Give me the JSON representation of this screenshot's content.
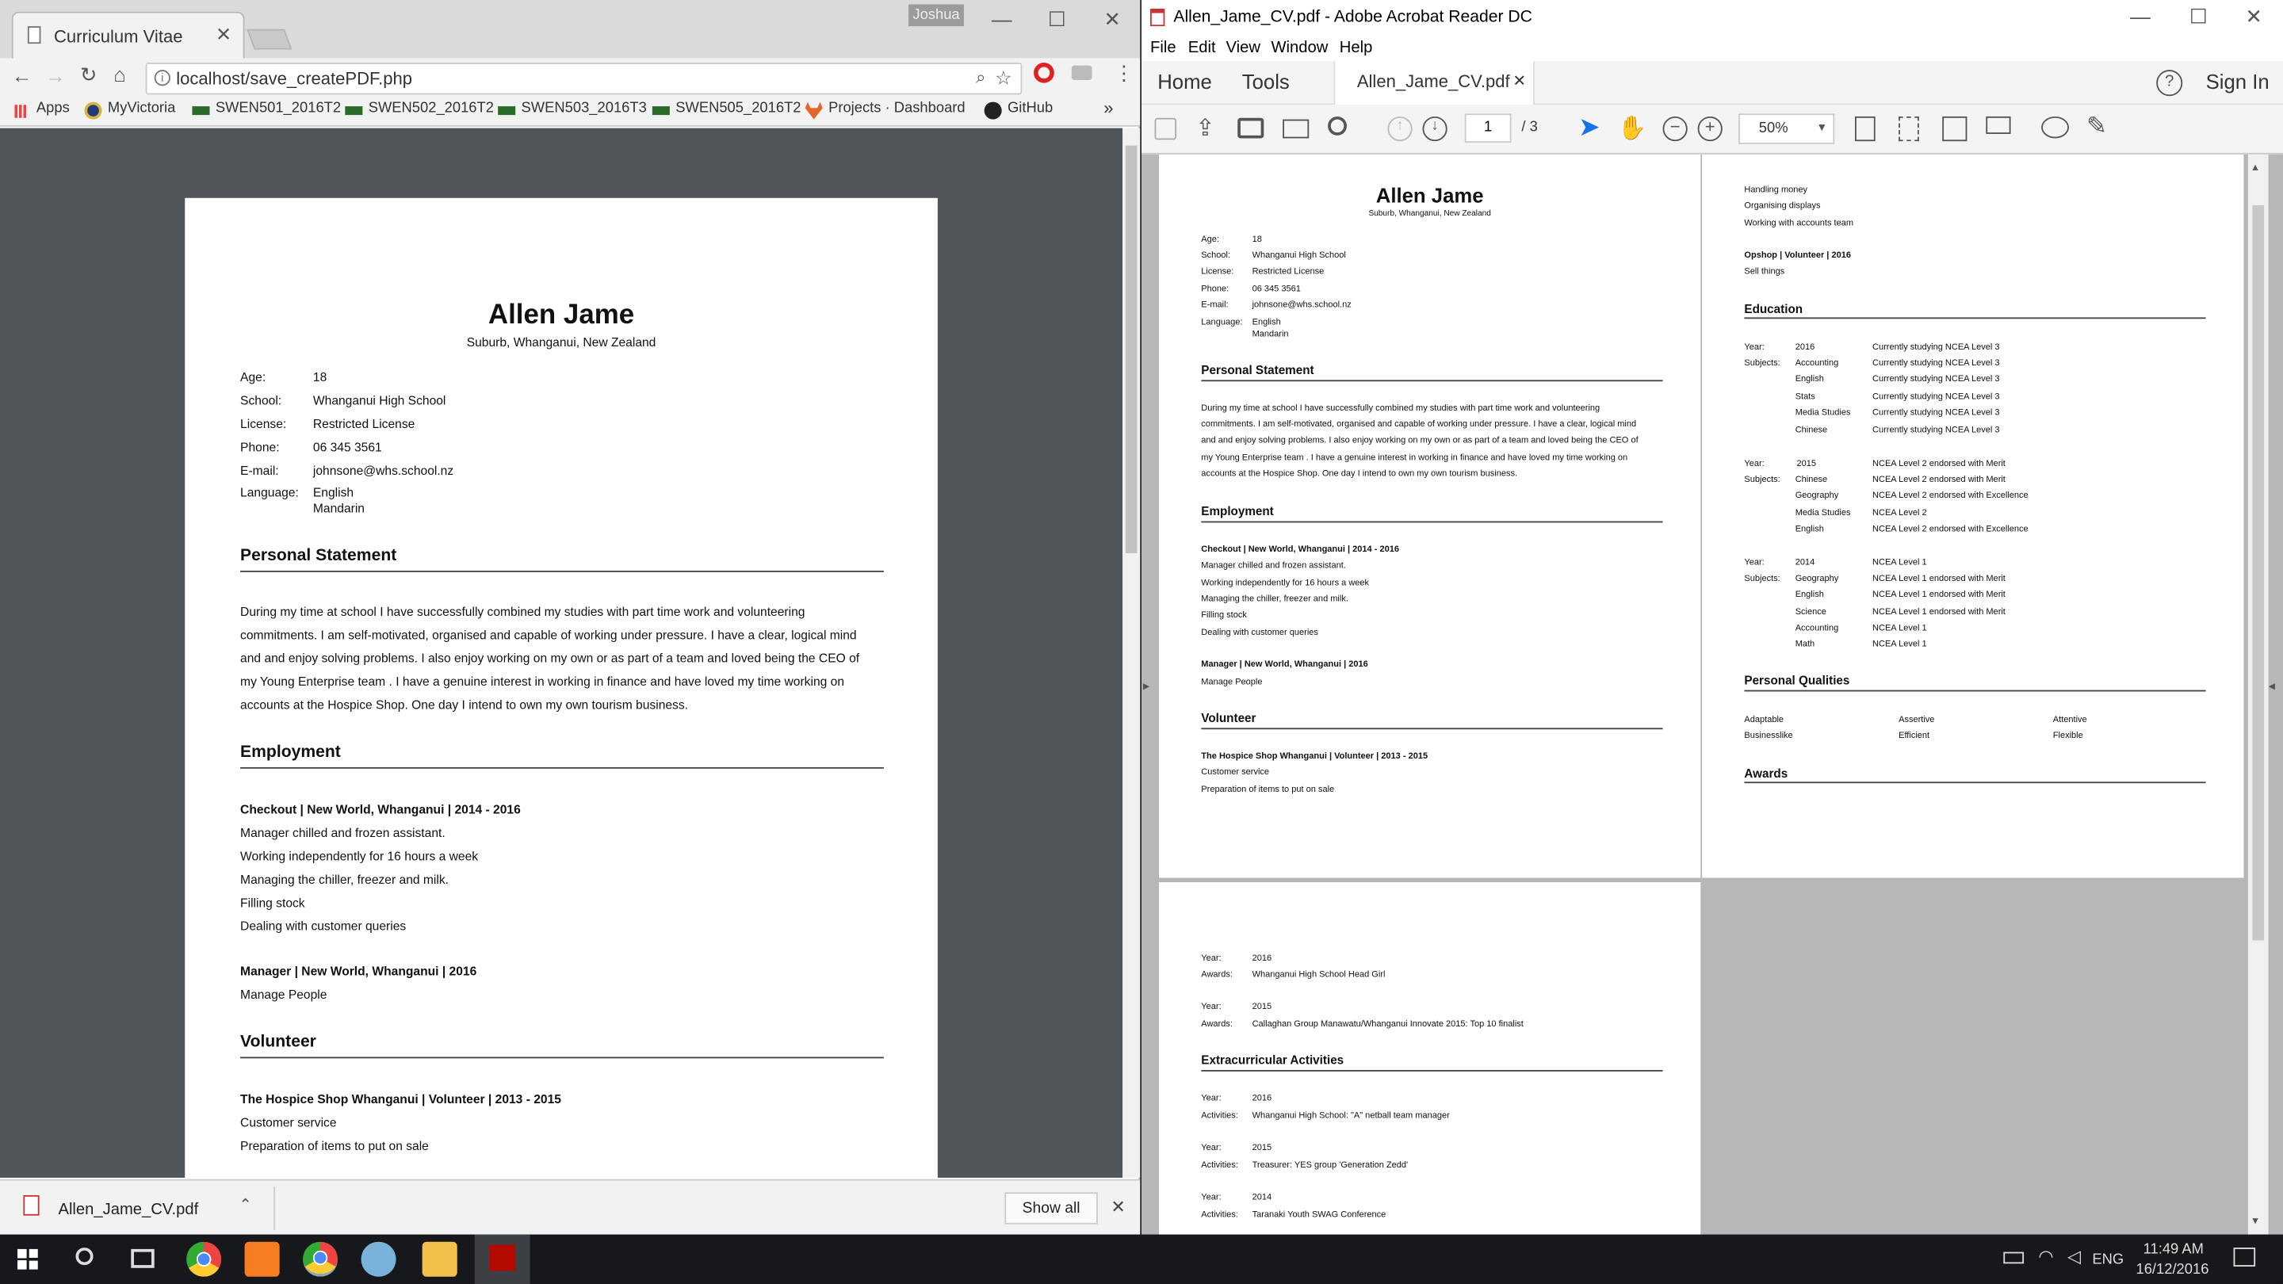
{
  "chrome": {
    "tab_title": "Curriculum Vitae",
    "profile_name": "Joshua",
    "url": "localhost/save_createPDF.php",
    "bookmarks": [
      "Apps",
      "MyVictoria",
      "SWEN501_2016T2",
      "SWEN502_2016T2",
      "SWEN503_2016T3",
      "SWEN505_2016T2",
      "Projects · Dashboard",
      "GitHub"
    ],
    "download_file": "Allen_Jame_CV.pdf",
    "show_all": "Show all"
  },
  "cv": {
    "name": "Allen Jame",
    "address": "Suburb, Whanganui, New Zealand",
    "details": [
      {
        "label": "Age:",
        "value": "18"
      },
      {
        "label": "School:",
        "value": "Whanganui High School"
      },
      {
        "label": "License:",
        "value": "Restricted License"
      },
      {
        "label": "Phone:",
        "value": "06 345 3561"
      },
      {
        "label": "E-mail:",
        "value": "johnsone@whs.school.nz"
      },
      {
        "label": "Language:",
        "value": "English"
      }
    ],
    "language_2": "Mandarin",
    "personal_statement_heading": "Personal Statement",
    "statement_lines": [
      "During my time at school I have successfully combined my studies with part time work and volunteering",
      "commitments. I am self-motivated, organised and capable of working under pressure. I have a clear, logical mind",
      "and and enjoy solving problems. I also enjoy working on my own or as part of a team and loved being the CEO of",
      "my Young Enterprise team . I have a genuine interest in working in finance and have loved my time working on",
      "accounts at the Hospice Shop. One day I intend to own my own tourism business."
    ],
    "employment_heading": "Employment",
    "job1_title": "Checkout | New World, Whanganui | 2014 - 2016",
    "job1_items": [
      "Manager chilled and frozen assistant.",
      "Working independently for 16 hours a week",
      "Managing the chiller, freezer and milk.",
      "Filling stock",
      "Dealing with customer queries"
    ],
    "job2_title": "Manager |  New World, Whanganui | 2016",
    "job2_items": [
      "Manage People"
    ],
    "volunteer_heading": "Volunteer",
    "vol1_title": "The Hospice Shop Whanganui | Volunteer | 2013 - 2015",
    "vol1_items": [
      "Customer service",
      "Preparation of items to put on sale"
    ],
    "page2_top_items": [
      "Handling money",
      "Organising displays",
      "Working with accounts team"
    ],
    "vol2_title": "Opshop | Volunteer | 2016",
    "vol2_items": [
      "Sell things"
    ],
    "education_heading": "Education",
    "education": [
      {
        "year": "2016",
        "subjects": [
          [
            "Accounting",
            "Currently studying NCEA Level 3"
          ],
          [
            "English",
            "Currently studying NCEA Level 3"
          ],
          [
            "Stats",
            "Currently studying NCEA Level 3"
          ],
          [
            "Media Studies",
            "Currently studying NCEA Level 3"
          ],
          [
            "Chinese",
            "Currently studying NCEA Level 3"
          ]
        ],
        "year_note": "Currently studying NCEA Level 3"
      },
      {
        "year": "2015",
        "subjects": [
          [
            "Chinese",
            "NCEA Level 2 endorsed with Merit"
          ],
          [
            "Geography",
            "NCEA Level 2 endorsed with Excellence"
          ],
          [
            "Media Studies",
            "NCEA Level 2"
          ],
          [
            "English",
            "NCEA Level 2 endorsed with Excellence"
          ]
        ],
        "year_note": "NCEA Level 2 endorsed with Merit"
      },
      {
        "year": "2014",
        "subjects": [
          [
            "Geography",
            "NCEA Level 1 endorsed with Merit"
          ],
          [
            "English",
            "NCEA Level 1 endorsed with Merit"
          ],
          [
            "Science",
            "NCEA Level 1 endorsed with Merit"
          ],
          [
            "Accounting",
            "NCEA Level 1"
          ],
          [
            "Math",
            "NCEA Level 1"
          ]
        ],
        "year_note": "NCEA Level 1"
      }
    ],
    "qualities_heading": "Personal Qualities",
    "qualities": [
      "Adaptable",
      "Assertive",
      "Attentive",
      "Businesslike",
      "Efficient",
      "Flexible"
    ],
    "awards_heading": "Awards",
    "awards": [
      {
        "year": "2016",
        "text": "Whanganui High School Head Girl"
      },
      {
        "year": "2015",
        "text": "Callaghan Group Manawatu/Whanganui Innovate 2015: Top 10 finalist"
      }
    ],
    "extra_heading": "Extracurricular Activities",
    "activities": [
      {
        "year": "2016",
        "text": "Whanganui High School: \"A\" netball team manager"
      },
      {
        "year": "2015",
        "text": "Treasurer: YES group 'Generation Zedd'"
      },
      {
        "year": "2014",
        "text": "Taranaki Youth SWAG Conference"
      }
    ],
    "labels": {
      "year": "Year:",
      "subjects": "Subjects:",
      "awards": "Awards:",
      "activities": "Activities:"
    }
  },
  "acrobat": {
    "title": "Allen_Jame_CV.pdf - Adobe Acrobat Reader DC",
    "menu": [
      "File",
      "Edit",
      "View",
      "Window",
      "Help"
    ],
    "nav_home": "Home",
    "nav_tools": "Tools",
    "doc_tab": "Allen_Jame_CV.pdf",
    "sign_in": "Sign In",
    "page_current": "1",
    "page_total": "/ 3",
    "zoom": "50%"
  },
  "taskbar": {
    "lang": "ENG",
    "time": "11:49 AM",
    "date": "16/12/2016"
  },
  "colors": {
    "accent_blue": "#1473e6",
    "chrome_viewer": "#525659",
    "taskbar": "#16181b"
  }
}
